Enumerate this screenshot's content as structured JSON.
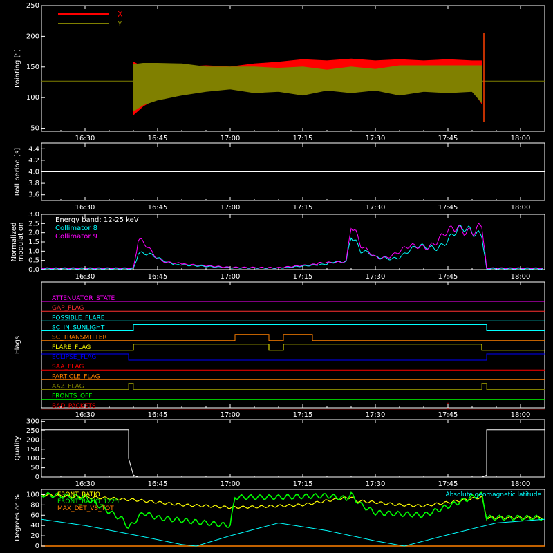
{
  "chart_data": [
    {
      "id": "pointing",
      "type": "area",
      "ylabel": "Pointing [\"]",
      "ylim": [
        45,
        250
      ],
      "yticks": [
        50,
        100,
        150,
        200,
        250
      ],
      "xticks": [
        "16:30",
        "16:45",
        "17:00",
        "17:15",
        "17:30",
        "17:45",
        "18:00"
      ],
      "legend": [
        "X",
        "Y"
      ],
      "legend_placement": "top-left",
      "series": [
        {
          "name": "X",
          "color": "#ff0000",
          "x": [
            "16:40",
            "16:42",
            "16:45",
            "16:50",
            "16:55",
            "17:00",
            "17:05",
            "17:10",
            "17:15",
            "17:20",
            "17:25",
            "17:30",
            "17:35",
            "17:40",
            "17:45",
            "17:50",
            "17:52"
          ],
          "upper": [
            158,
            150,
            150,
            150,
            152,
            150,
            155,
            158,
            162,
            160,
            163,
            160,
            162,
            160,
            162,
            160,
            160
          ],
          "lower": [
            72,
            86,
            100,
            108,
            112,
            115,
            112,
            116,
            113,
            117,
            115,
            118,
            116,
            118,
            117,
            115,
            90
          ]
        },
        {
          "name": "Y",
          "color": "#808000",
          "x": [
            "16:40",
            "16:42",
            "16:45",
            "16:50",
            "16:55",
            "17:00",
            "17:05",
            "17:10",
            "17:15",
            "17:20",
            "17:25",
            "17:30",
            "17:35",
            "17:40",
            "17:45",
            "17:50",
            "17:52"
          ],
          "upper": [
            154,
            156,
            156,
            155,
            150,
            150,
            150,
            148,
            150,
            145,
            150,
            146,
            152,
            152,
            152,
            152,
            152
          ],
          "lower": [
            78,
            88,
            96,
            104,
            110,
            114,
            108,
            110,
            104,
            112,
            108,
            112,
            104,
            110,
            108,
            110,
            92
          ]
        }
      ],
      "baseline": 127
    },
    {
      "id": "roll",
      "type": "line",
      "ylabel": "Roll period [s]",
      "ylim": [
        3.5,
        4.5
      ],
      "yticks": [
        "3.6",
        "3.8",
        "4.0",
        "4.2",
        "4.4"
      ],
      "xticks": [
        "16:30",
        "16:45",
        "17:00",
        "17:15",
        "17:30",
        "17:45",
        "18:00"
      ],
      "series": [
        {
          "x": [
            "16:21",
            "18:05"
          ],
          "values": [
            4.0,
            4.0
          ],
          "color": "#ffffff"
        }
      ]
    },
    {
      "id": "modulation",
      "type": "line",
      "ylabel": "Normalized\nmodulation",
      "ylim": [
        0,
        3
      ],
      "yticks": [
        "0.0",
        "0.5",
        "1.0",
        "1.5",
        "2.0",
        "2.5",
        "3.0"
      ],
      "xticks": [
        "16:30",
        "16:45",
        "17:00",
        "17:15",
        "17:30",
        "17:45",
        "18:00"
      ],
      "legend_title": "Energy band: 12-25 keV",
      "legend_placement": "top-left",
      "series": [
        {
          "name": "Collimator 8",
          "color": "#00ffff",
          "x": [
            "16:21",
            "16:40",
            "16:41",
            "16:45",
            "16:50",
            "17:00",
            "17:10",
            "17:20",
            "17:24",
            "17:25",
            "17:27",
            "17:30",
            "17:35",
            "17:40",
            "17:45",
            "17:50",
            "17:52",
            "17:53",
            "18:05"
          ],
          "values": [
            0.05,
            0.05,
            1.0,
            0.55,
            0.25,
            0.1,
            0.08,
            0.3,
            0.5,
            2.3,
            1.0,
            0.6,
            0.75,
            1.2,
            1.6,
            2.2,
            2.3,
            0.05,
            0.05
          ]
        },
        {
          "name": "Collimator 9",
          "color": "#ff00ff",
          "x": [
            "16:21",
            "16:40",
            "16:41",
            "16:45",
            "16:50",
            "17:00",
            "17:10",
            "17:20",
            "17:24",
            "17:25",
            "17:27",
            "17:30",
            "17:35",
            "17:40",
            "17:45",
            "17:50",
            "17:52",
            "17:53",
            "18:05"
          ],
          "values": [
            0.08,
            0.08,
            1.5,
            0.6,
            0.3,
            0.12,
            0.1,
            0.35,
            0.55,
            2.5,
            1.1,
            0.7,
            0.9,
            1.4,
            1.8,
            2.5,
            2.5,
            0.08,
            0.08
          ]
        }
      ]
    },
    {
      "id": "flags",
      "type": "line",
      "ylabel": "Flags",
      "xticks": [
        "16:30",
        "16:45",
        "17:00",
        "17:15",
        "17:30",
        "17:45",
        "18:00"
      ],
      "series": [
        {
          "name": "ATTENUATOR_STATE",
          "color": "#ff00ff",
          "x": [
            "16:21",
            "18:05"
          ],
          "values": [
            0,
            0
          ]
        },
        {
          "name": "GAP_FLAG",
          "color": "#ff3030",
          "x": [
            "16:21",
            "18:05"
          ],
          "values": [
            0,
            0
          ]
        },
        {
          "name": "POSSIBLE_FLARE",
          "color": "#00ffff",
          "x": [
            "16:21",
            "18:05"
          ],
          "values": [
            0,
            0
          ]
        },
        {
          "name": "SC_IN_SUNLIGHT",
          "color": "#00ffff",
          "x": [
            "16:21",
            "16:40",
            "16:40",
            "17:53",
            "17:53",
            "18:05"
          ],
          "values": [
            0,
            0,
            1,
            1,
            0,
            0
          ]
        },
        {
          "name": "SC_TRANSMITTER",
          "color": "#ff8000",
          "x": [
            "16:21",
            "17:01",
            "17:01",
            "17:08",
            "17:08",
            "17:11",
            "17:11",
            "17:17",
            "17:17",
            "18:05"
          ],
          "values": [
            0,
            0,
            1,
            1,
            0,
            0,
            1,
            1,
            0,
            0
          ]
        },
        {
          "name": "FLARE_FLAG",
          "color": "#ffff00",
          "x": [
            "16:21",
            "16:40",
            "16:40",
            "17:08",
            "17:08",
            "17:11",
            "17:11",
            "17:52",
            "17:52",
            "18:05"
          ],
          "values": [
            0,
            0,
            1,
            1,
            0,
            0,
            1,
            1,
            0,
            0
          ]
        },
        {
          "name": "ECLIPSE_FLAG",
          "color": "#0000ff",
          "x": [
            "16:21",
            "16:39",
            "16:39",
            "17:53",
            "17:53",
            "18:05"
          ],
          "values": [
            1,
            1,
            0,
            0,
            1,
            1
          ]
        },
        {
          "name": "SAA_FLAG",
          "color": "#ff0000",
          "x": [
            "16:21",
            "18:05"
          ],
          "values": [
            0,
            0
          ]
        },
        {
          "name": "PARTICLE_FLAG",
          "color": "#ff8000",
          "x": [
            "16:21",
            "18:05"
          ],
          "values": [
            0,
            0
          ]
        },
        {
          "name": "AAZ_FLAG",
          "color": "#808000",
          "x": [
            "16:21",
            "16:39",
            "16:39",
            "16:40",
            "16:40",
            "17:52",
            "17:52",
            "17:53",
            "17:53",
            "18:05"
          ],
          "values": [
            0,
            0,
            1,
            1,
            0,
            0,
            1,
            1,
            0,
            0
          ]
        },
        {
          "name": "FRONTS_OFF",
          "color": "#00ff00",
          "x": [
            "16:21",
            "18:05"
          ],
          "values": [
            0,
            0
          ]
        },
        {
          "name": "BAD_PACKETS",
          "color": "#ff0000",
          "x": [
            "16:21",
            "17:45",
            "17:45",
            "17:45",
            "17:45",
            "18:05"
          ],
          "values": [
            0,
            0,
            1,
            1,
            0,
            0
          ]
        }
      ]
    },
    {
      "id": "quality",
      "type": "line",
      "ylabel": "Quality",
      "ylim": [
        0,
        310
      ],
      "yticks": [
        "0",
        "50",
        "100",
        "150",
        "200",
        "250",
        "300"
      ],
      "xticks": [
        "16:30",
        "16:45",
        "17:00",
        "17:15",
        "17:30",
        "17:45",
        "18:00"
      ],
      "series": [
        {
          "color": "#ffffff",
          "x": [
            "16:21",
            "16:39",
            "16:39",
            "16:40",
            "16:41",
            "17:52",
            "17:53",
            "17:53",
            "18:05"
          ],
          "values": [
            255,
            255,
            100,
            10,
            0,
            0,
            10,
            255,
            255
          ]
        }
      ]
    },
    {
      "id": "ratios",
      "type": "line",
      "ylabel": "Degrees or %",
      "ylim": [
        0,
        110
      ],
      "yticks": [
        "0",
        "20",
        "40",
        "60",
        "80",
        "100"
      ],
      "legend_placement": "top-left",
      "series": [
        {
          "name": "FRONT_RATIO",
          "color": "#ffff00",
          "x": [
            "16:21",
            "16:30",
            "16:35",
            "16:39",
            "16:40",
            "16:50",
            "16:55",
            "17:00",
            "17:05",
            "17:10",
            "17:15",
            "17:20",
            "17:25",
            "17:26",
            "17:30",
            "17:35",
            "17:40",
            "17:45",
            "17:50",
            "17:52",
            "17:53",
            "18:05"
          ],
          "values": [
            100,
            95,
            93,
            90,
            90,
            80,
            78,
            75,
            76,
            78,
            80,
            88,
            95,
            88,
            85,
            80,
            78,
            85,
            92,
            95,
            55,
            55
          ]
        },
        {
          "name": "FRONT_RATIO_1225",
          "color": "#00ff00",
          "x": [
            "16:21",
            "16:30",
            "16:38",
            "16:39",
            "16:42",
            "16:45",
            "16:50",
            "16:55",
            "17:00",
            "17:01",
            "17:10",
            "17:20",
            "17:24",
            "17:25",
            "17:27",
            "17:30",
            "17:40",
            "17:50",
            "17:52",
            "17:53",
            "18:05"
          ],
          "values": [
            100,
            95,
            50,
            35,
            65,
            55,
            50,
            45,
            40,
            95,
            95,
            98,
            92,
            100,
            80,
            65,
            60,
            95,
            100,
            55,
            55
          ]
        },
        {
          "name": "MAX_DET_VS_TOT",
          "color": "#ff8000",
          "x": [
            "16:21",
            "18:05"
          ],
          "values": [
            0,
            0
          ]
        },
        {
          "name": "Absolute geomagnetic latitude",
          "color": "#00ffff",
          "x": [
            "16:21",
            "16:30",
            "16:40",
            "16:50",
            "16:53",
            "17:00",
            "17:10",
            "17:20",
            "17:30",
            "17:36",
            "17:45",
            "17:55",
            "18:05"
          ],
          "values": [
            52,
            40,
            22,
            3,
            0,
            20,
            45,
            30,
            10,
            0,
            22,
            45,
            52
          ]
        }
      ]
    }
  ]
}
